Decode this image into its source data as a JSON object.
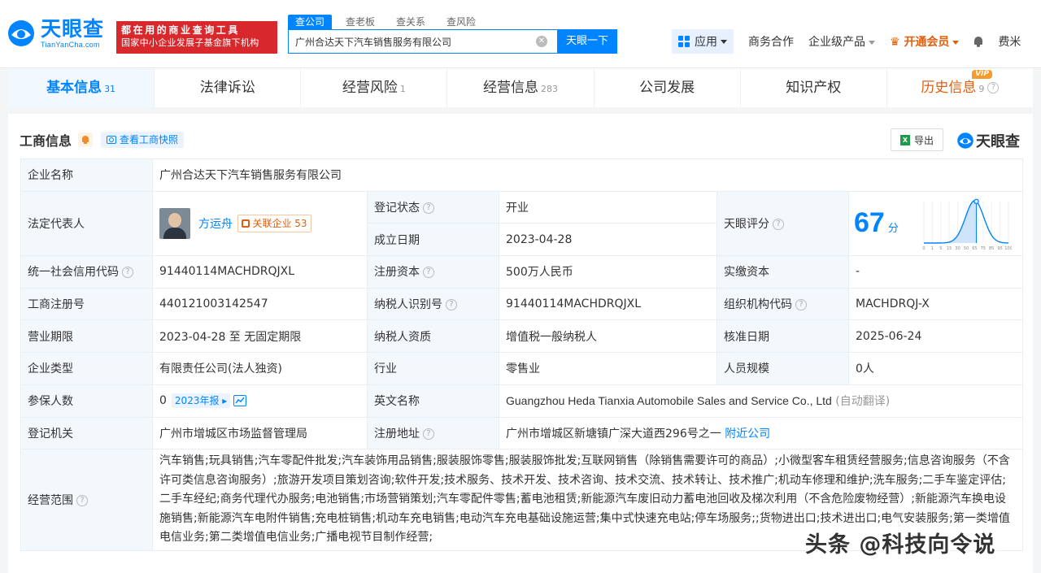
{
  "header": {
    "logo_cn": "天眼查",
    "logo_en": "TianYanCha.com",
    "promo_line1": "都在用的商业查询工具",
    "promo_line2": "国家中小企业发展子基金旗下机构",
    "search_tabs": [
      "查公司",
      "查老板",
      "查关系",
      "查风险"
    ],
    "search_value": "广州合达天下汽车销售服务有限公司",
    "search_button": "天眼一下",
    "apps_label": "应用",
    "nav": [
      "商务合作",
      "企业级产品",
      "开通会员",
      "费米"
    ]
  },
  "tabs": [
    {
      "label": "基本信息",
      "count": "31"
    },
    {
      "label": "法律诉讼",
      "count": ""
    },
    {
      "label": "经营风险",
      "count": "1"
    },
    {
      "label": "经营信息",
      "count": "283"
    },
    {
      "label": "公司发展",
      "count": ""
    },
    {
      "label": "知识产权",
      "count": ""
    },
    {
      "label": "历史信息",
      "count": "9"
    }
  ],
  "vip_badge": "VIP",
  "section": {
    "title": "工商信息",
    "snapshot_label": "查看工商快照",
    "export_label": "导出",
    "brand": "天眼查"
  },
  "info": {
    "company_name_label": "企业名称",
    "company_name": "广州合达天下汽车销售服务有限公司",
    "legal_rep_label": "法定代表人",
    "legal_rep": "方运舟",
    "related_label": "关联企业",
    "related_count": "53",
    "reg_status_label": "登记状态",
    "reg_status": "开业",
    "founded_label": "成立日期",
    "founded": "2023-04-28",
    "score_label": "天眼评分",
    "score": "67",
    "score_unit": "分",
    "score_ticks": [
      "0",
      "1",
      "5",
      "15",
      "30",
      "50",
      "65",
      "75",
      "85",
      "95",
      "100"
    ],
    "credit_code_label": "统一社会信用代码",
    "credit_code": "91440114MACHDRQJXL",
    "reg_capital_label": "注册资本",
    "reg_capital": "500万人民币",
    "paid_capital_label": "实缴资本",
    "paid_capital": "-",
    "reg_no_label": "工商注册号",
    "reg_no": "440121003142547",
    "taxpayer_id_label": "纳税人识别号",
    "taxpayer_id": "91440114MACHDRQJXL",
    "org_code_label": "组织机构代码",
    "org_code": "MACHDRQJ-X",
    "term_label": "营业期限",
    "term": "2023-04-28 至 无固定期限",
    "taxpayer_type_label": "纳税人资质",
    "taxpayer_type": "增值税一般纳税人",
    "approval_date_label": "核准日期",
    "approval_date": "2025-06-24",
    "company_type_label": "企业类型",
    "company_type": "有限责任公司(法人独资)",
    "industry_label": "行业",
    "industry": "零售业",
    "staff_label": "人员规模",
    "staff": "0人",
    "insured_label": "参保人数",
    "insured": "0",
    "insured_year": "2023年报",
    "english_name_label": "英文名称",
    "english_name": "Guangzhou Heda Tianxia Automobile Sales and Service Co., Ltd",
    "auto_translate": "(自动翻译)",
    "authority_label": "登记机关",
    "authority": "广州市增城区市场监督管理局",
    "address_label": "注册地址",
    "address": "广州市增城区新塘镇广深大道西296号之一",
    "nearby_label": "附近公司",
    "scope_label": "经营范围",
    "scope": "汽车销售;玩具销售;汽车零配件批发;汽车装饰用品销售;服装服饰零售;服装服饰批发;互联网销售（除销售需要许可的商品）;小微型客车租赁经营服务;信息咨询服务（不含许可类信息咨询服务）;旅游开发项目策划咨询;软件开发;技术服务、技术开发、技术咨询、技术交流、技术转让、技术推广;机动车修理和维护;洗车服务;二手车鉴定评估;二手车经纪;商务代理代办服务;电池销售;市场营销策划;汽车零配件零售;蓄电池租赁;新能源汽车废旧动力蓄电池回收及梯次利用（不含危险废物经营）;新能源汽车换电设施销售;新能源汽车电附件销售;充电桩销售;机动车充电销售;电动汽车充电基础设施运营;集中式快速充电站;停车场服务;;货物进出口;技术进出口;电气安装服务;第一类增值电信业务;第二类增值电信业务;广播电视节目制作经营;"
  },
  "watermark": "头条 @科技向令说",
  "colors": {
    "accent": "#0084ff",
    "promo_red": "#d8282c",
    "vip_orange": "#e05f0f",
    "status_green": "#00a65a"
  }
}
